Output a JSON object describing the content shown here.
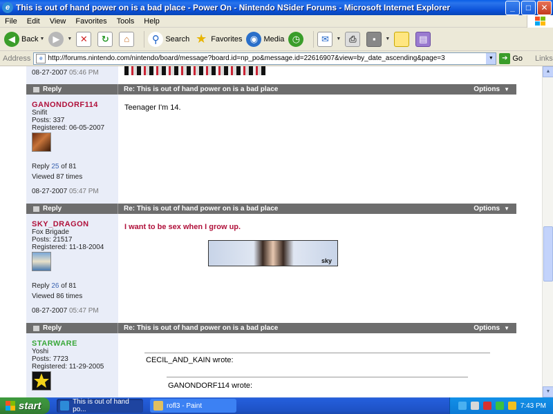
{
  "window": {
    "title": "This is out of hand power on is a bad place - Power On - Nintendo NSider Forums - Microsoft Internet Explorer",
    "minimize": "_",
    "maximize": "□",
    "close": "✕"
  },
  "menu": [
    "File",
    "Edit",
    "View",
    "Favorites",
    "Tools",
    "Help"
  ],
  "toolbar": {
    "back": "Back",
    "search": "Search",
    "favorites": "Favorites",
    "media": "Media"
  },
  "address": {
    "label": "Address",
    "url": "http://forums.nintendo.com/nintendo/board/message?board.id=np_po&message.id=22616907&view=by_date_ascending&page=3",
    "go": "Go",
    "links": "Links"
  },
  "prev_post": {
    "date": "08-27-2007",
    "time": "05:46 PM"
  },
  "posts": [
    {
      "reply_label": "Reply",
      "subject": "Re: This is out of hand power on is a bad place",
      "options_label": "Options",
      "username": "GANONDORF114",
      "username_color": "#b0103a",
      "rank": "Snifit",
      "posts": "Posts: 337",
      "registered": "Registered: 06-05-2007",
      "reply_prefix": "Reply",
      "reply_num": "25",
      "reply_total": "of 81",
      "viewed": "Viewed 87 times",
      "date": "08-27-2007",
      "time": "05:47 PM",
      "body": "Teenager I'm 14."
    },
    {
      "reply_label": "Reply",
      "subject": "Re: This is out of hand power on is a bad place",
      "options_label": "Options",
      "username": "SKY_DRAGON",
      "username_color": "#b0103a",
      "rank": "Fox Brigade",
      "posts": "Posts: 21517",
      "registered": "Registered: 11-18-2004",
      "reply_prefix": "Reply",
      "reply_num": "26",
      "reply_total": "of 81",
      "viewed": "Viewed 86 times",
      "date": "08-27-2007",
      "time": "05:47 PM",
      "body": "I want to be sex when I grow up.",
      "signature_label": "sky"
    },
    {
      "reply_label": "Reply",
      "subject": "Re: This is out of hand power on is a bad place",
      "options_label": "Options",
      "username": "STARWARE",
      "username_color": "#3aa83a",
      "rank": "Yoshi",
      "posts": "Posts: 7723",
      "registered": "Registered: 11-29-2005",
      "quote1": "CECIL_AND_KAIN wrote:",
      "quote2": "GANONDORF114 wrote:"
    }
  ],
  "taskbar": {
    "start": "start",
    "items": [
      {
        "label": "This is out of hand po..."
      },
      {
        "label": "rofl3 - Paint"
      }
    ],
    "clock": "7:43 PM"
  }
}
